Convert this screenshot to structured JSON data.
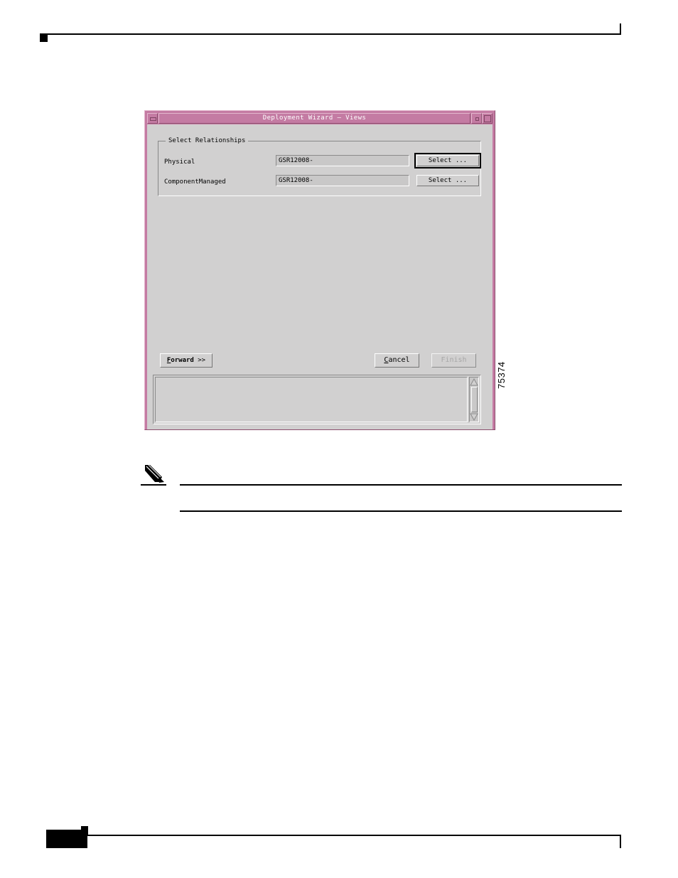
{
  "document_page": {
    "header": {
      "marker_icon": "black-square-marker",
      "rule": "horizontal-rule"
    },
    "footer": {
      "block_icon": "black-block-marker",
      "rule": "horizontal-rule"
    },
    "note_callout": {
      "icon": "pencil-note-icon",
      "body_text": ""
    },
    "figure": {
      "id_label": "75374"
    }
  },
  "window": {
    "title": "Deployment Wizard — Views",
    "titlebar_colors": {
      "background": "#c47ba3",
      "title_text": "#ffffff",
      "highlight": "#e3b6cd",
      "shadow": "#8c4f6e"
    },
    "client_color": "#d1d0d0",
    "controls": {
      "minimize_label": "minimize-icon",
      "restore_label": "restore-icon",
      "maximize_label": "maximize-icon"
    }
  },
  "groupbox": {
    "legend": "Select Relationships",
    "rows": [
      {
        "label": "Physical",
        "value": "GSR12008-",
        "placeholder": "",
        "button_label": "Select ...",
        "focused": true
      },
      {
        "label": "ComponentManaged",
        "value": "GSR12008-",
        "placeholder": "",
        "button_label": "Select ...",
        "focused": false
      }
    ]
  },
  "actions": {
    "forward": {
      "mnemonic": "F",
      "rest": "orward",
      "arrows": " >>",
      "enabled": true
    },
    "cancel": {
      "mnemonic": "C",
      "rest": "ancel",
      "enabled": true
    },
    "finish": {
      "label": "Finish",
      "enabled": false
    }
  },
  "log_panel": {
    "text": "",
    "scrollbar": {
      "up_icon": "scroll-up-arrow-icon",
      "down_icon": "scroll-down-arrow-icon"
    }
  }
}
